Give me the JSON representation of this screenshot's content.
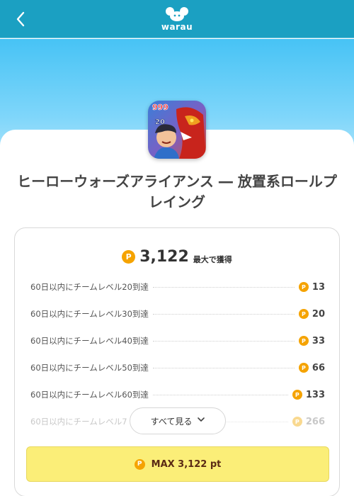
{
  "header": {
    "brand": "warau",
    "back_icon": "chevron-left-icon",
    "background": "#1ba0c2"
  },
  "app": {
    "title": "ヒーローウォーズアライアンス ― 放置系ロールプレイング",
    "icon_badge_top": "999",
    "icon_badge_level": "20"
  },
  "points": {
    "coin_symbol": "P",
    "total": "3,122",
    "total_suffix": "最大で獲得"
  },
  "rewards": [
    {
      "label": "60日以内にチームレベル20到達",
      "points": "13"
    },
    {
      "label": "60日以内にチームレベル30到達",
      "points": "20"
    },
    {
      "label": "60日以内にチームレベル40到達",
      "points": "33"
    },
    {
      "label": "60日以内にチームレベル50到達",
      "points": "66"
    },
    {
      "label": "60日以内にチームレベル60到達",
      "points": "133"
    },
    {
      "label": "60日以内にチームレベル7",
      "points": "266"
    }
  ],
  "see_all": {
    "label": "すべて見る",
    "icon": "chevron-down-icon"
  },
  "cta": {
    "label": "MAX 3,122 pt",
    "background": "#fbee78"
  },
  "colors": {
    "coin": "#f5a300",
    "accent": "#1ba0c2"
  }
}
